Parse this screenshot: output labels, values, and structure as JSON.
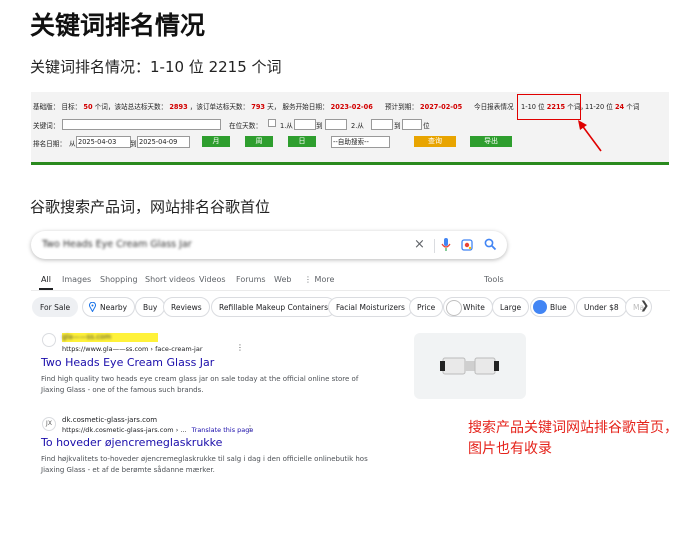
{
  "title": "关键词排名情况",
  "subtitle_1": "关键词排名情况：1-10 位 2215 个词",
  "subtitle_2": "谷歌搜索产品词，网站排名谷歌首位",
  "stats_panel": {
    "basic": "基础版：",
    "target_prefix": "目标：",
    "target_value": "50",
    "target_mid": "个词，该站总达标天数：",
    "total_days": "2893",
    "days_mid": "，该订单达标天数：",
    "order_days": "793",
    "days_unit": "天，",
    "start_label": "服务开始日期：",
    "start_date": "2023-02-06",
    "expire_label": "预计到期：",
    "expire_date": "2027-02-05",
    "today_label": "今日报表情况",
    "rank1_range": "1-10 位",
    "rank1_value": "2215",
    "rank1_unit": "个词，",
    "rank2_range": "11-20 位",
    "rank2_value": "24",
    "rank2_unit": "个词",
    "keyword_label": "关键词：",
    "position_days_label": "在位天数：",
    "opt1_label": "1.从",
    "to_label_1": "到",
    "opt2_label": "2.从",
    "to_label_2": "到",
    "rank_unit": "位",
    "date_label": "排名日期：",
    "from_label": "从",
    "date_from": "2025-04-03",
    "date_to_label": "到",
    "date_to": "2025-04-09",
    "btn_month": "月",
    "btn_week": "周",
    "btn_day": "日",
    "select_value": "--自助搜索--",
    "btn_query": "查询",
    "btn_export": "导出"
  },
  "google": {
    "search_query": "Two Heads Eye Cream Glass Jar",
    "nav_tabs": [
      "All",
      "Images",
      "Shopping",
      "Short videos",
      "Videos",
      "Forums",
      "Web",
      "⋮ More"
    ],
    "tools": "Tools",
    "chips": [
      "For Sale",
      "Nearby",
      "Buy",
      "Reviews",
      "Refillable Makeup Containers",
      "Facial Moisturizers",
      "Price",
      "White",
      "Large",
      "Blue",
      "Under $8",
      "Ma"
    ],
    "result1": {
      "site_name": "gla——ss.com",
      "url": "https://www.gla——ss.com › face-cream-jar",
      "title": "Two Heads Eye Cream Glass Jar",
      "desc": "Find high quality two heads eye cream glass jar on sale today at the official online store of Jiaxing Glass - one of the famous such brands."
    },
    "result2": {
      "favicon": "JX",
      "site_name": "dk.cosmetic-glass-jars.com",
      "url": "https://dk.cosmetic-glass-jars.com › ...",
      "translate": "Translate this page",
      "title": "To hoveder øjencremeglaskrukke",
      "desc": "Find højkvalitets to-hoveder øjencremeglaskrukke til salg i dag i den officielle onlinebutik hos Jiaxing Glass - et af de berømte sådanne mærker."
    },
    "colors": {
      "link": "#1a0dab",
      "chip_blue": "#4285f4",
      "green": "#2a8a1e",
      "red_note": "#e5231b"
    }
  },
  "annotation": "搜索产品关键词网站排谷歌首页，图片也有收录"
}
